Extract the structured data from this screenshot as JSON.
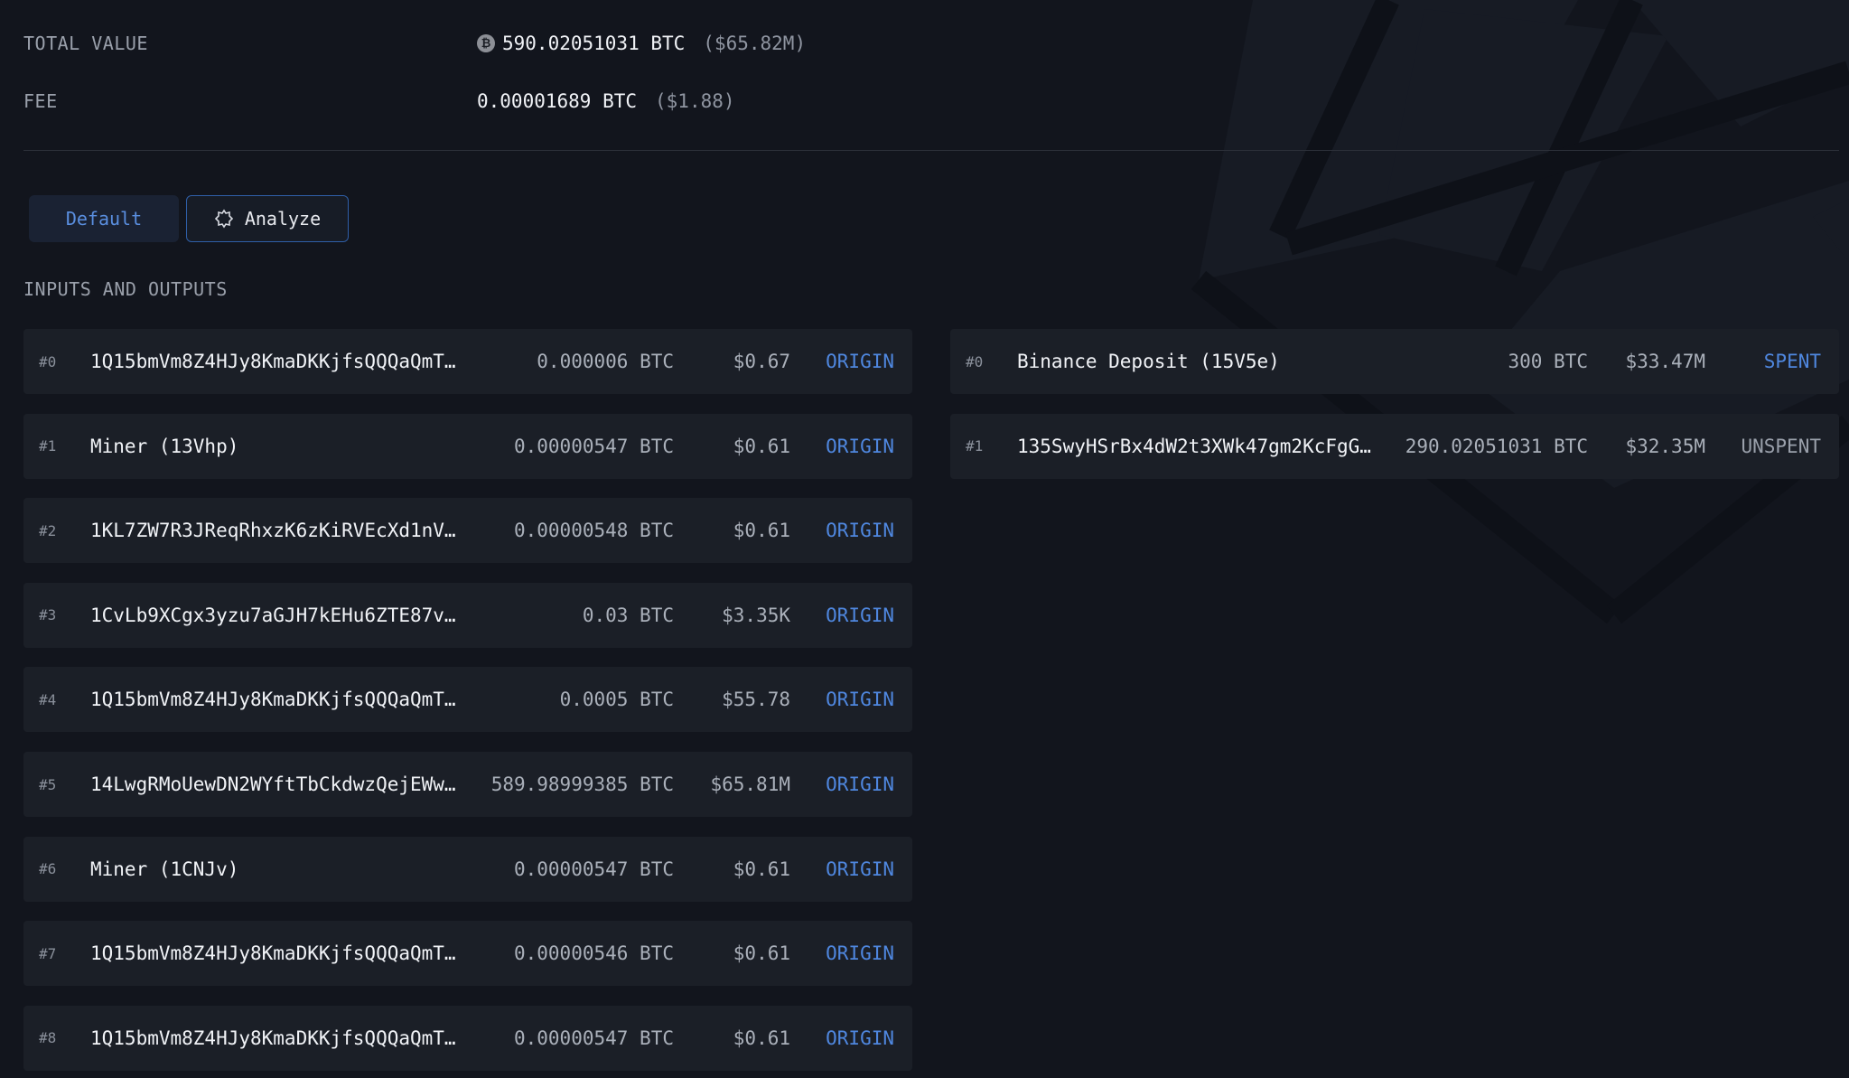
{
  "summary": {
    "total_value_label": "TOTAL VALUE",
    "total_value_btc": "590.02051031 BTC",
    "total_value_usd": "($65.82M)",
    "fee_label": "FEE",
    "fee_btc": "0.00001689 BTC",
    "fee_usd": "($1.88)",
    "btc_symbol": "₿"
  },
  "tabs": {
    "default_label": "Default",
    "analyze_label": "Analyze"
  },
  "section_title": "INPUTS AND OUTPUTS",
  "inputs": [
    {
      "index": "#0",
      "address": "1Q15bmVm8Z4HJy8KmaDKKjfsQQQaQmT…",
      "btc": "0.000006 BTC",
      "usd": "$0.67",
      "status": "ORIGIN"
    },
    {
      "index": "#1",
      "address": "Miner (13Vhp)",
      "btc": "0.00000547 BTC",
      "usd": "$0.61",
      "status": "ORIGIN"
    },
    {
      "index": "#2",
      "address": "1KL7ZW7R3JReqRhxzK6zKiRVEcXd1nV…",
      "btc": "0.00000548 BTC",
      "usd": "$0.61",
      "status": "ORIGIN"
    },
    {
      "index": "#3",
      "address": "1CvLb9XCgx3yzu7aGJH7kEHu6ZTE87v…",
      "btc": "0.03 BTC",
      "usd": "$3.35K",
      "status": "ORIGIN"
    },
    {
      "index": "#4",
      "address": "1Q15bmVm8Z4HJy8KmaDKKjfsQQQaQmT…",
      "btc": "0.0005 BTC",
      "usd": "$55.78",
      "status": "ORIGIN"
    },
    {
      "index": "#5",
      "address": "14LwgRMoUewDN2WYftTbCkdwzQejEWw…",
      "btc": "589.98999385 BTC",
      "usd": "$65.81M",
      "status": "ORIGIN"
    },
    {
      "index": "#6",
      "address": "Miner (1CNJv)",
      "btc": "0.00000547 BTC",
      "usd": "$0.61",
      "status": "ORIGIN"
    },
    {
      "index": "#7",
      "address": "1Q15bmVm8Z4HJy8KmaDKKjfsQQQaQmT…",
      "btc": "0.00000546 BTC",
      "usd": "$0.61",
      "status": "ORIGIN"
    },
    {
      "index": "#8",
      "address": "1Q15bmVm8Z4HJy8KmaDKKjfsQQQaQmT…",
      "btc": "0.00000547 BTC",
      "usd": "$0.61",
      "status": "ORIGIN"
    }
  ],
  "outputs": [
    {
      "index": "#0",
      "address": "Binance Deposit (15V5e)",
      "btc": "300 BTC",
      "usd": "$33.47M",
      "status": "SPENT"
    },
    {
      "index": "#1",
      "address": "135SwyHSrBx4dW2t3XWk47gm2KcFgG…",
      "btc": "290.02051031 BTC",
      "usd": "$32.35M",
      "status": "UNSPENT"
    }
  ],
  "colors": {
    "background": "#12151d",
    "row_background": "#1b1f27",
    "accent_blue": "#4f87df",
    "muted": "#9aa0ab"
  }
}
